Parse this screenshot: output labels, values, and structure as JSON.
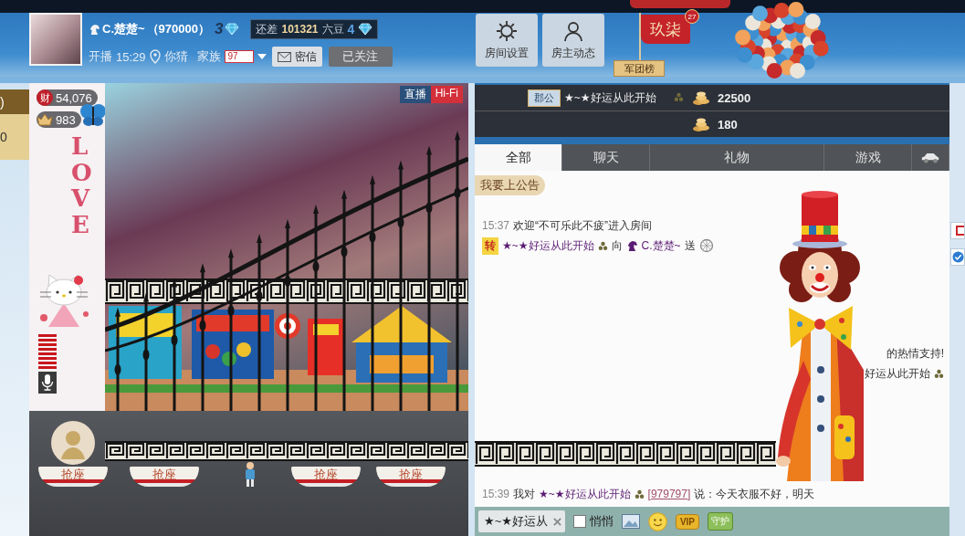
{
  "header": {
    "name": "C.楚楚~",
    "room_id": "（970000）",
    "level": "3",
    "progress": {
      "prefix": "还差",
      "amount": "101321",
      "unit": "六豆",
      "next_level": "4"
    },
    "start_label": "开播",
    "start_time": "15:29",
    "location": "你猜",
    "family_label": "家族",
    "family_badge": "97",
    "buttons": [
      {
        "kind": "message",
        "label": "密信"
      },
      {
        "kind": "follow",
        "label": "已关注"
      }
    ]
  },
  "room_buttons": [
    {
      "kind": "settings",
      "label": "房间设置"
    },
    {
      "kind": "profile",
      "label": "房主动态"
    }
  ],
  "legion": {
    "flag": "玖柒",
    "count": "27",
    "board": "军团榜"
  },
  "side_tabs": [
    ")",
    "0"
  ],
  "stage": {
    "stats": [
      {
        "kind": "wealth",
        "badge": "财",
        "value": "54,076"
      },
      {
        "kind": "crown",
        "value": "983"
      }
    ],
    "tags": [
      {
        "kind": "live",
        "label": "直播"
      },
      {
        "kind": "hifi",
        "label": "Hi-Fi"
      }
    ],
    "pendant": "LOVE",
    "seats": [
      {
        "kind": "avatar",
        "label": "抢座"
      },
      {
        "kind": "empty",
        "label": "抢座"
      },
      {
        "kind": "occupied"
      },
      {
        "kind": "empty",
        "label": "抢座"
      },
      {
        "kind": "empty",
        "label": "抢座"
      }
    ]
  },
  "ranking": [
    {
      "title": "郡公",
      "name": "★~★好运从此开始",
      "amount": "22500"
    },
    {
      "amount": "180"
    }
  ],
  "chat": {
    "tabs": [
      {
        "kind": "text",
        "label": "全部",
        "selected": true
      },
      {
        "kind": "text",
        "label": "聊天",
        "selected": false
      },
      {
        "kind": "text",
        "label": "礼物",
        "selected": false
      },
      {
        "kind": "text",
        "label": "游戏",
        "selected": false
      },
      {
        "kind": "car",
        "selected": false
      }
    ],
    "announce": "我要上公告",
    "messages": [
      {
        "kind": "enter",
        "time": "15:37",
        "text": "欢迎“不可乐此不疲”进入房间"
      },
      {
        "kind": "gift",
        "badge": "转",
        "from": "★~★好运从此开始",
        "verb": "向",
        "to": "C.楚楚~",
        "action": "送"
      },
      {
        "kind": "fragment",
        "text": "的热情支持!",
        "symbol": false
      },
      {
        "kind": "fragment",
        "text": "好运从此开始",
        "symbol": true
      },
      {
        "kind": "private",
        "time": "15:39",
        "prefix": "我对",
        "to": "★~★好运从此开始",
        "id": "[979797]",
        "text": "说：今天衣服不好，明天"
      }
    ],
    "input": {
      "recipient": "★~★好运从",
      "whisper": {
        "label": "悄悄",
        "checked": false
      },
      "tools": [
        {
          "kind": "image"
        },
        {
          "kind": "emoji"
        },
        {
          "kind": "vip",
          "label": "VIP"
        },
        {
          "kind": "guard",
          "label": "守护"
        }
      ]
    }
  }
}
